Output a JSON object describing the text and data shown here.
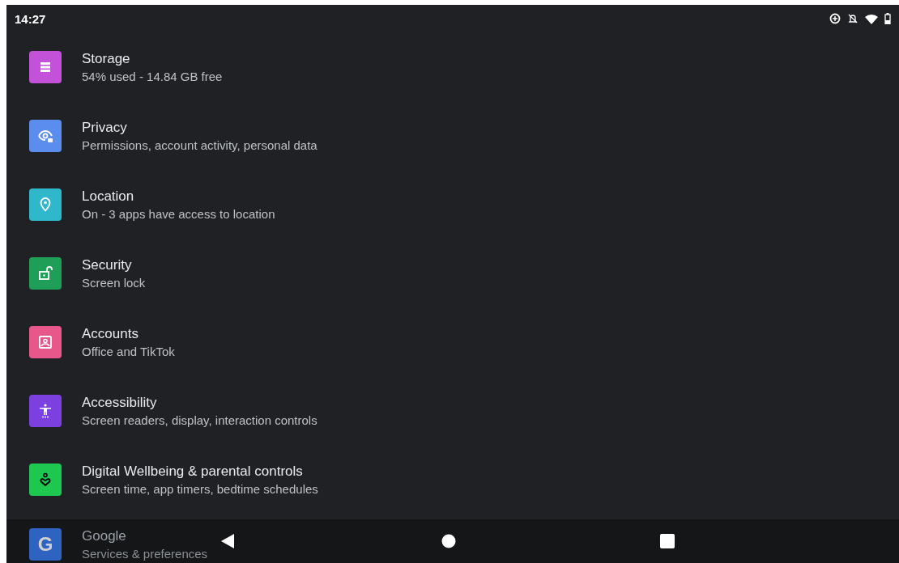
{
  "status_bar": {
    "time": "14:27"
  },
  "settings": [
    {
      "kind": "storage",
      "title": "Storage",
      "subtitle": "54% used - 14.84 GB free",
      "color": "#c452d9"
    },
    {
      "kind": "privacy",
      "title": "Privacy",
      "subtitle": "Permissions, account activity, personal data",
      "color": "#5b8def"
    },
    {
      "kind": "location",
      "title": "Location",
      "subtitle": "On - 3 apps have access to location",
      "color": "#2fb8cc"
    },
    {
      "kind": "security",
      "title": "Security",
      "subtitle": "Screen lock",
      "color": "#1e9e57"
    },
    {
      "kind": "accounts",
      "title": "Accounts",
      "subtitle": "Office and TikTok",
      "color": "#e8578a"
    },
    {
      "kind": "accessibility",
      "title": "Accessibility",
      "subtitle": "Screen readers, display, interaction controls",
      "color": "#7c3fe0"
    },
    {
      "kind": "wellbeing",
      "title": "Digital Wellbeing & parental controls",
      "subtitle": "Screen time, app timers, bedtime schedules",
      "color": "#1ec74f"
    },
    {
      "kind": "google",
      "glyph": "G",
      "title": "Google",
      "subtitle": "Services & preferences",
      "color": "#2f63c2"
    }
  ]
}
